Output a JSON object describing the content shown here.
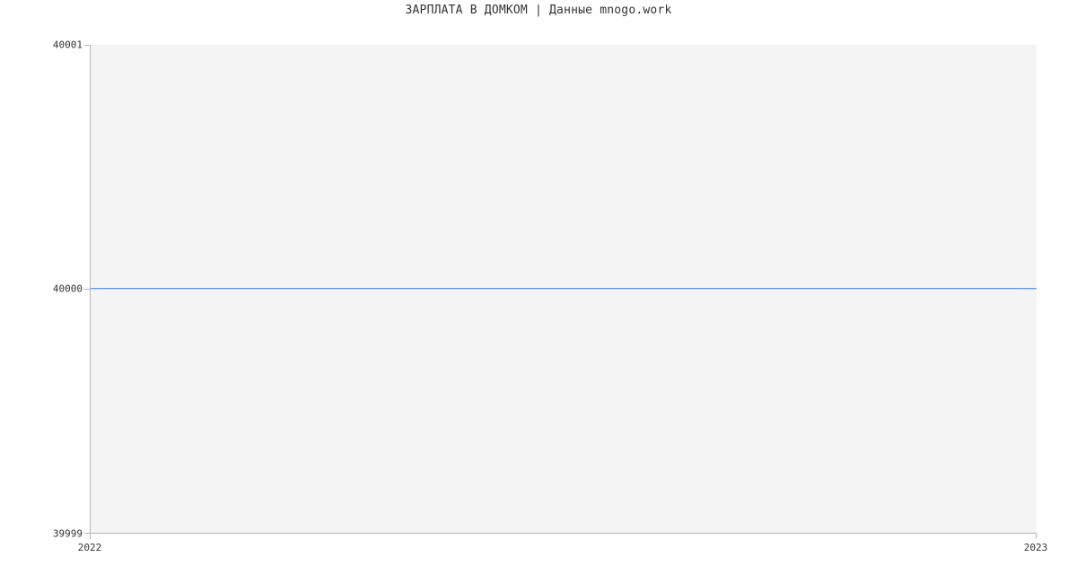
{
  "chart_data": {
    "type": "line",
    "title": "ЗАРПЛАТА В ДОМКОМ | Данные mnogo.work",
    "xlabel": "",
    "ylabel": "",
    "x": [
      "2022",
      "2023"
    ],
    "values": [
      40000,
      40000
    ],
    "ylim": [
      39999,
      40001
    ],
    "y_ticks": [
      "40001",
      "40000",
      "39999"
    ],
    "x_ticks": [
      "2022",
      "2023"
    ],
    "line_color": "#3d7fe0",
    "plot_bg": "#f4f4f4"
  }
}
